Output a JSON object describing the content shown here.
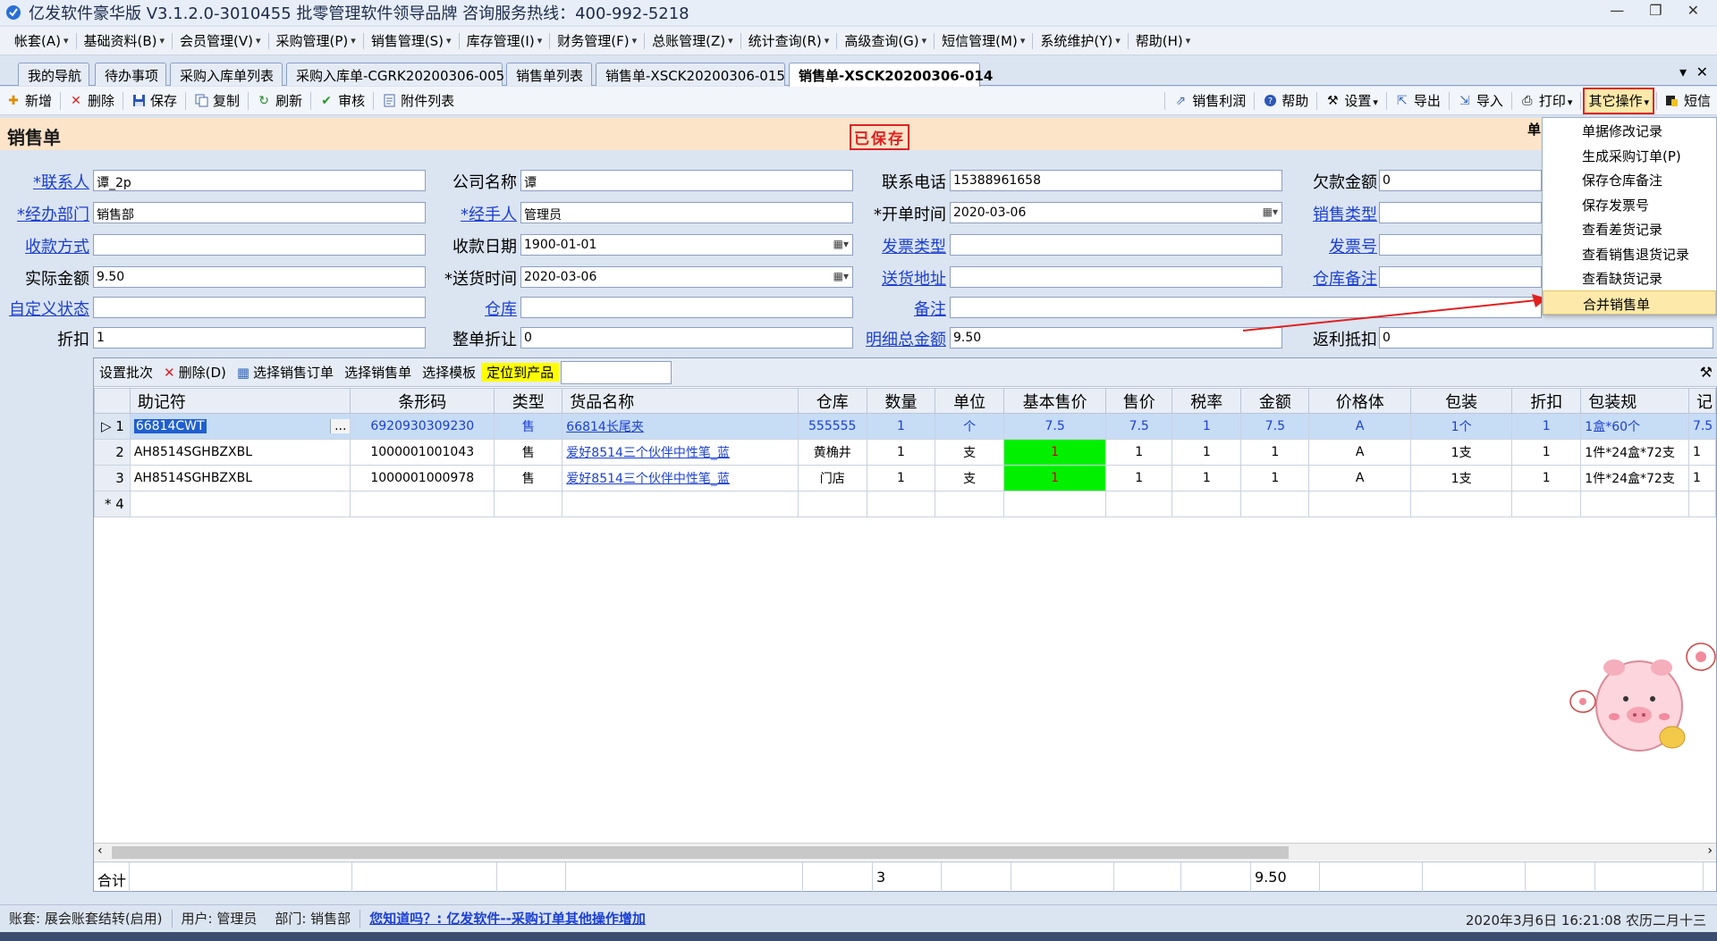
{
  "window": {
    "title": "亿发软件豪华版 V3.1.2.0-3010455 批零管理软件领导品牌 咨询服务热线：400-992-5218",
    "minimize": "—",
    "restore": "❐",
    "close": "✕"
  },
  "menu": [
    "帐套(A)",
    "基础资料(B)",
    "会员管理(V)",
    "采购管理(P)",
    "销售管理(S)",
    "库存管理(I)",
    "财务管理(F)",
    "总账管理(Z)",
    "统计查询(R)",
    "高级查询(G)",
    "短信管理(M)",
    "系统维护(Y)",
    "帮助(H)"
  ],
  "tabs": [
    "我的导航",
    "待办事项",
    "采购入库单列表",
    "采购入库单-CGRK20200306-005",
    "销售单列表",
    "销售单-XSCK20200306-015",
    "销售单-XSCK20200306-014"
  ],
  "tab_controls": {
    "dropdown": "▾",
    "close": "✕"
  },
  "toolbar": {
    "new": "新增",
    "delete": "删除",
    "save": "保存",
    "copy": "复制",
    "refresh": "刷新",
    "audit": "审核",
    "attachments": "附件列表",
    "profit": "销售利润",
    "help": "帮助",
    "settings": "设置",
    "export": "导出",
    "import": "导入",
    "print": "打印",
    "other": "其它操作",
    "sms": "短信"
  },
  "form": {
    "title": "销售单",
    "stamp": "已保存",
    "doc_no_label": "单",
    "fields": {
      "contact": {
        "label": "*联系人",
        "value": "谭_2p"
      },
      "company": {
        "label": "公司名称",
        "value": "谭"
      },
      "phone": {
        "label": "联系电话",
        "value": "15388961658"
      },
      "owed": {
        "label": "欠款金额",
        "value": "0"
      },
      "dept": {
        "label": "*经办部门",
        "value": "销售部"
      },
      "handler": {
        "label": "*经手人",
        "value": "管理员"
      },
      "open_time": {
        "label": "*开单时间",
        "value": "2020-03-06"
      },
      "sale_type": {
        "label": "销售类型",
        "value": ""
      },
      "pay_method": {
        "label": "收款方式",
        "value": ""
      },
      "pay_date": {
        "label": "收款日期",
        "value": "1900-01-01"
      },
      "invoice_type": {
        "label": "发票类型",
        "value": ""
      },
      "invoice_no": {
        "label": "发票号",
        "value": ""
      },
      "actual_amount": {
        "label": "实际金额",
        "value": "9.50"
      },
      "delivery_time": {
        "label": "*送货时间",
        "value": "2020-03-06"
      },
      "delivery_addr": {
        "label": "送货地址",
        "value": ""
      },
      "wh_note": {
        "label": "仓库备注",
        "value": ""
      },
      "custom_status": {
        "label": "自定义状态",
        "value": ""
      },
      "warehouse": {
        "label": "仓库",
        "value": ""
      },
      "remark": {
        "label": "备注",
        "value": ""
      },
      "discount": {
        "label": "折扣",
        "value": "1"
      },
      "whole_discount": {
        "label": "整单折让",
        "value": "0"
      },
      "detail_total": {
        "label": "明细总金额",
        "value": "9.50"
      },
      "rebate": {
        "label": "返利抵扣",
        "value": "0"
      }
    },
    "date_picker_icon": "▦▾"
  },
  "grid_toolbar": {
    "set_batch": "设置批次",
    "delete": "删除(D)",
    "select_order": "选择销售订单",
    "select_sale": "选择销售单",
    "select_template": "选择模板",
    "locate": "定位到产品",
    "wrench": "⚒"
  },
  "grid": {
    "columns": [
      "",
      "助记符",
      "条形码",
      "类型",
      "货品名称",
      "仓库",
      "数量",
      "单位",
      "基本售价",
      "售价",
      "税率",
      "金额",
      "价格体",
      "包装",
      "折扣",
      "包装规",
      "记"
    ],
    "rows": [
      {
        "idx": "▷ 1",
        "code": "66814CWT",
        "barcode": "6920930309230",
        "type": "售",
        "name": "66814长尾夹",
        "wh": "555555",
        "qty": "1",
        "unit": "个",
        "base": "7.5",
        "price": "7.5",
        "tax": "1",
        "amount": "7.5",
        "tier": "A",
        "pack": "1个",
        "disc": "1",
        "spec": "1盒*60个",
        "rec": "7.5"
      },
      {
        "idx": "2",
        "code": "AH8514SGHBZXBL",
        "barcode": "1000001001043",
        "type": "售",
        "name": "爱好8514三个伙伴中性笔_蓝",
        "wh": "黄桷井",
        "qty": "1",
        "unit": "支",
        "base": "1",
        "price": "1",
        "tax": "1",
        "amount": "1",
        "tier": "A",
        "pack": "1支",
        "disc": "1",
        "spec": "1件*24盒*72支",
        "rec": "1"
      },
      {
        "idx": "3",
        "code": "AH8514SGHBZXBL",
        "barcode": "1000001000978",
        "type": "售",
        "name": "爱好8514三个伙伴中性笔_蓝",
        "wh": "门店",
        "qty": "1",
        "unit": "支",
        "base": "1",
        "price": "1",
        "tax": "1",
        "amount": "1",
        "tier": "A",
        "pack": "1支",
        "disc": "1",
        "spec": "1件*24盒*72支",
        "rec": "1"
      },
      {
        "idx": "* 4",
        "code": "",
        "barcode": "",
        "type": "",
        "name": "",
        "wh": "",
        "qty": "",
        "unit": "",
        "base": "",
        "price": "",
        "tax": "",
        "amount": "",
        "tier": "",
        "pack": "",
        "disc": "",
        "spec": "",
        "rec": ""
      }
    ],
    "summary": {
      "label": "合计",
      "qty": "3",
      "amount": "9.50"
    },
    "scroll_left": "‹",
    "scroll_right": "›"
  },
  "dropdown_menu": [
    "单据修改记录",
    "生成采购订单(P)",
    "保存仓库备注",
    "保存发票号",
    "查看差货记录",
    "查看销售退货记录",
    "查看缺货记录",
    "合并销售单"
  ],
  "status": {
    "account": "账套: 展会账套结转(启用)",
    "user": "用户: 管理员",
    "dept": "部门: 销售部",
    "tip": "您知道吗？: 亿发软件--采购订单其他操作增加",
    "datetime": "2020年3月6日 16:21:08 农历二月十三"
  },
  "colors": {
    "accent_red": "#e02020",
    "link_blue": "#1a3fd6",
    "highlight_yellow": "#ffff00",
    "green_cell": "#00f000"
  }
}
